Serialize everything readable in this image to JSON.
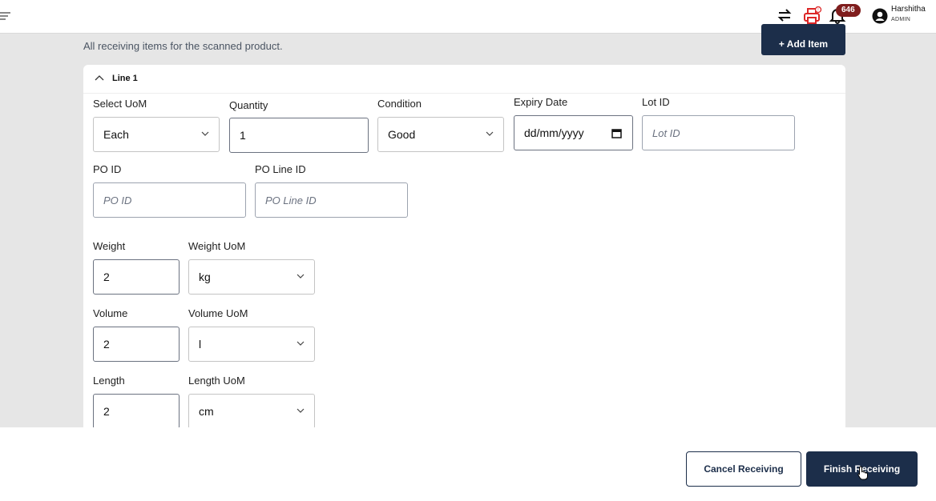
{
  "header": {
    "user_name": "Harshitha",
    "user_role": "ADMIN",
    "notification_count": "646",
    "icons": [
      "menu-icon",
      "swap-icon",
      "printer-icon",
      "bell-icon",
      "user-icon"
    ]
  },
  "page": {
    "subtitle": "All receiving items for the scanned product.",
    "add_item_label": "+ Add Item"
  },
  "line": {
    "title": "Line 1",
    "select_uom": {
      "label": "Select UoM",
      "value": "Each"
    },
    "quantity": {
      "label": "Quantity",
      "value": "1"
    },
    "condition": {
      "label": "Condition",
      "value": "Good"
    },
    "expiry_date": {
      "label": "Expiry Date",
      "placeholder": "dd/mm/yyyy"
    },
    "lot_id": {
      "label": "Lot ID",
      "placeholder": "Lot ID"
    },
    "po_id": {
      "label": "PO ID",
      "placeholder": "PO ID"
    },
    "po_line_id": {
      "label": "PO Line ID",
      "placeholder": "PO Line ID"
    },
    "weight": {
      "label": "Weight",
      "value": "2"
    },
    "weight_uom": {
      "label": "Weight UoM",
      "value": "kg"
    },
    "volume": {
      "label": "Volume",
      "value": "2"
    },
    "volume_uom": {
      "label": "Volume UoM",
      "value": "l"
    },
    "length": {
      "label": "Length",
      "value": "2"
    },
    "length_uom": {
      "label": "Length UoM",
      "value": "cm"
    }
  },
  "footer": {
    "cancel_label": "Cancel Receiving",
    "finish_label": "Finish Receiving"
  },
  "colors": {
    "primary": "#1c2e4a",
    "badge": "#7f1d1d",
    "printer": "#dc2626"
  }
}
